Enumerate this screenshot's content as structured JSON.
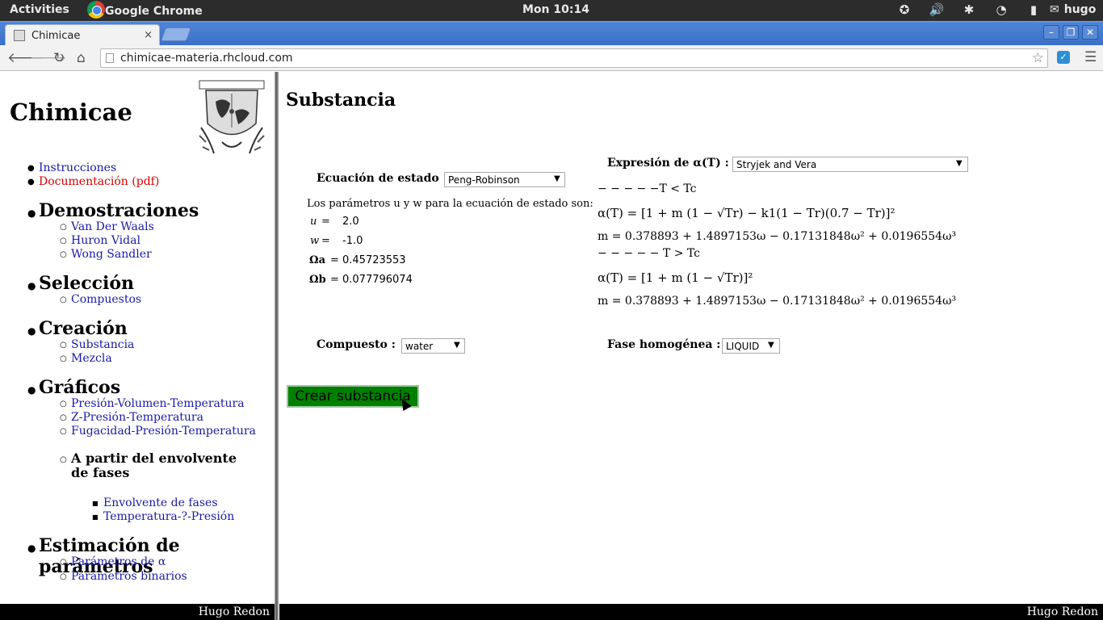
{
  "system_bar": {
    "activities": "Activities",
    "app_name": "Google Chrome",
    "clock": "Mon 10:14",
    "user": "hugo"
  },
  "browser": {
    "tab_title": "Chimicae",
    "tab_close": "×",
    "url": "chimicae-materia.rhcloud.com"
  },
  "sidebar": {
    "title": "Chimicae",
    "top_links": [
      {
        "label": "Instrucciones",
        "color": "#1a1aa6"
      },
      {
        "label": "Documentación (pdf)",
        "color": "#d40000"
      }
    ],
    "sections": [
      {
        "heading": "Demostraciones",
        "items": [
          "Van Der Waals",
          "Huron Vidal",
          "Wong Sandler"
        ]
      },
      {
        "heading": "Selección",
        "items": [
          "Compuestos"
        ]
      },
      {
        "heading": "Creación",
        "items": [
          "Substancia",
          "Mezcla"
        ]
      },
      {
        "heading": "Gráficos",
        "items": [
          "Presión-Volumen-Temperatura",
          "Z-Presión-Temperatura",
          "Fugacidad-Presión-Temperatura"
        ],
        "subsection": {
          "heading": "A partir del envolvente de fases",
          "items": [
            "Envolvente de fases",
            "Temperatura-?-Presión"
          ]
        }
      },
      {
        "heading": "Estimación de parámetros",
        "items": [
          "Parámetros de α",
          "Parámetros binarios"
        ]
      }
    ],
    "footer": "Hugo Redon"
  },
  "main": {
    "title": "Substancia",
    "eos_label": "Ecuación de estado :",
    "eos_value": "Peng-Robinson",
    "params_intro": "Los parámetros u y w para la ecuación de estado son:",
    "params": [
      {
        "name": "u",
        "eq": "=",
        "value": "2.0"
      },
      {
        "name": "w",
        "eq": "=",
        "value": "-1.0"
      },
      {
        "name": "Ωa",
        "eq": "=",
        "value": "0.45723553"
      },
      {
        "name": "Ωb",
        "eq": "=",
        "value": "0.077796074"
      }
    ],
    "alpha_label": "Expresión de α(T) :",
    "alpha_value": "Stryjek and Vera",
    "eq_case1": "− − − − −T < Tc",
    "eq_alpha1": "α(T) = [1 + m (1 − √Tr) − k1(1 − Tr)(0.7 − Tr)]²",
    "eq_m1": "m = 0.378893 + 1.4897153ω − 0.17131848ω² + 0.0196554ω³",
    "eq_case2": "− − − − − T > Tc",
    "eq_alpha2": "α(T) = [1 + m (1 − √Tr)]²",
    "eq_m2": "m = 0.378893 + 1.4897153ω − 0.17131848ω² + 0.0196554ω³",
    "compound_label": "Compuesto :",
    "compound_value": "water",
    "phase_label": "Fase homogénea :",
    "phase_value": "LIQUID",
    "create_button": "Crear substancia",
    "footer": "Hugo Redon"
  }
}
